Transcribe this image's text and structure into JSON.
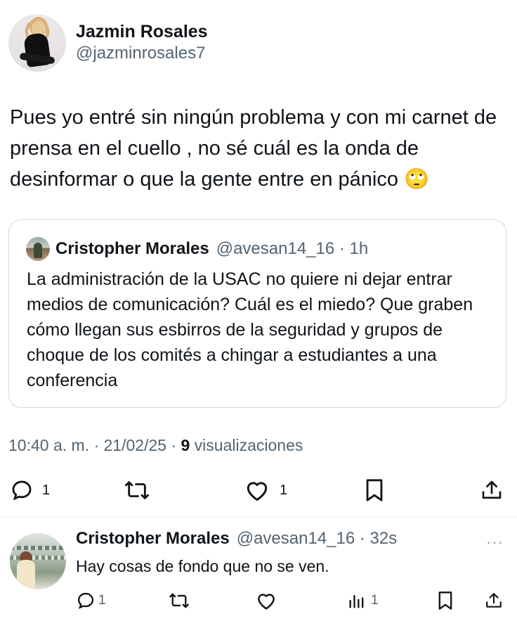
{
  "main_tweet": {
    "author_name": "Jazmin Rosales",
    "author_handle": "@jazminrosales7",
    "text": "Pues yo entré sin ningún problema y con mi carnet de prensa en el cuello , no sé cuál es la onda de desinformar o que la gente entre en pánico 🙄",
    "time": "10:40 a. m. · 21/02/25 · ",
    "views_count": "9",
    "views_label": " visualizaciones",
    "reply_count": "1",
    "retweet_count": "",
    "like_count": "1"
  },
  "quoted_tweet": {
    "author_name": "Cristopher Morales",
    "author_handle": "@avesan14_16 · 1h",
    "text": "La administración de la USAC no quiere ni dejar entrar medios de comunicación? Cuál es el miedo? Que graben cómo llegan sus esbirros de la seguridad y grupos de choque de los comités a chingar a estudiantes a una conferencia"
  },
  "reply": {
    "author_name": "Cristopher Morales",
    "author_handle": "@avesan14_16 · 32s",
    "more": "···",
    "text": "Hay cosas de fondo que no se ven.",
    "reply_count": "1",
    "retweet_count": "",
    "like_count": "",
    "views_count": "1"
  },
  "icons": [
    "reply-icon",
    "retweet-icon",
    "like-icon",
    "bookmark-icon",
    "share-icon",
    "views-icon",
    "more-icon"
  ],
  "colors": {
    "text": "#0f1419",
    "secondary": "#536471",
    "border": "#cfd9de"
  }
}
